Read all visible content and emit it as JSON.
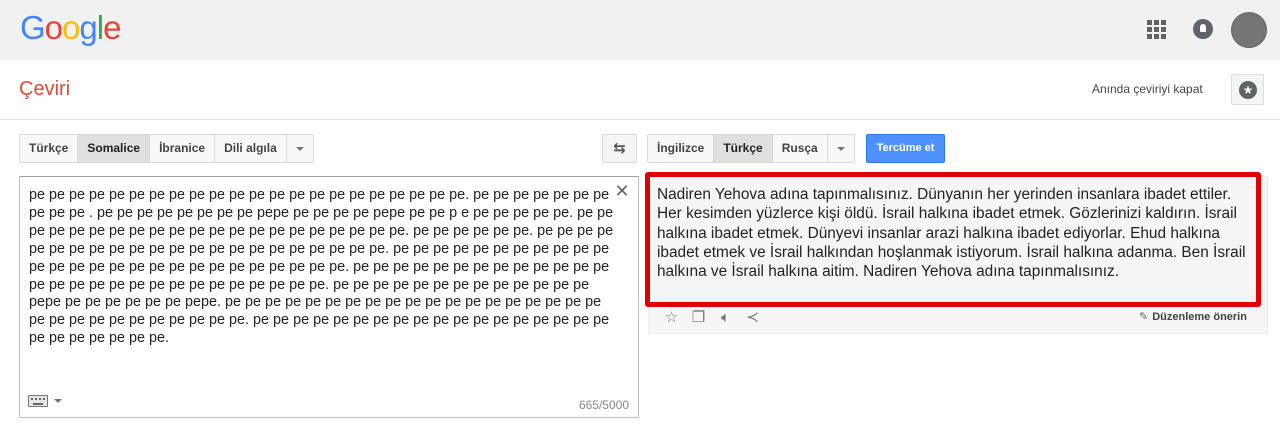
{
  "header": {
    "logo": {
      "letters": [
        "G",
        "o",
        "o",
        "g",
        "l",
        "e"
      ],
      "colors": [
        "#4285f4",
        "#ea4335",
        "#fbbc05",
        "#4285f4",
        "#34a853",
        "#ea4335"
      ]
    },
    "icons": [
      "apps-grid-icon",
      "notifications-icon",
      "account-avatar"
    ]
  },
  "titlebar": {
    "title": "Çeviri",
    "instant_translation_link": "Anında çeviriyi kapat",
    "star_icon": "phrasebook-star-icon"
  },
  "source": {
    "languages": [
      "Türkçe",
      "Somalice",
      "İbranice",
      "Dili algıla"
    ],
    "active_language": "Somalice",
    "text": "pe pe pe pe pe pe pe pe pe pe pe pe pe pe pe pe pe pe pe pe pe pe. pe pe pe pe pe pe pe pe pe pe . pe pe pe pe pe pe pe pe pepe pe pe pe pe pepe pe pe p e pe pe pe pe pe. pe pe pe pe pe pe pe pe pe pe pe pe pe pe pe pe pe pe pe pe pe. pe pe pe pe pe pe. pe pe pe pe pe pe pe pe pe pe pe pe pe pe pe pe pe pe pe pe pe pe. pe pe pe pe pe pe pe pe pe pe pe pe pe pe pe pe pe pe pe pe pe pe pe pe pe pe pe. pe pe pe pe pe pe pe pe pe pe pe pe pe pe pe pe pe pe pe pe pe pe pe pe pe pe pe pe. pe pe pe pe pe pe pe pe pe pe pe pe pe pepe pe pe pe pe pe pe pepe. pe pe pe pe pe pe pe pe pe pe pe pe pe pe pe pe pe pe pe pe pe pe pe pe pe pe pe pe pe pe. pe pe pe pe pe pe pe pe pe pe pe pe pe pe pe pe pe pe pe pe pe pe pe pe pe.",
    "char_count": "665/5000",
    "clear_icon": "close-x-icon",
    "keyboard_icon": "keyboard-icon"
  },
  "swap_icon": "swap-languages-icon",
  "target": {
    "languages": [
      "İngilizce",
      "Türkçe",
      "Rusça"
    ],
    "active_language": "Türkçe",
    "translate_button": "Tercüme et",
    "text": "Nadiren Yehova adına tapınmalısınız. Dünyanın her yerinden insanlara ibadet ettiler. Her kesimden yüzlerce kişi öldü. İsrail halkına ibadet etmek. Gözlerinizi kaldırın. İsrail halkına ibadet etmek. Dünyevi insanlar arazi halkına ibadet ediyorlar. Ehud halkına ibadet etmek ve İsrail halkından hoşlanmak istiyorum. İsrail halkına adanma. Ben İsrail halkına ve İsrail halkına aitim. Nadiren Yehova adına tapınmalısınız.",
    "highlight_color": "#e00000",
    "result_icons": [
      "star-icon",
      "copy-icon",
      "speaker-icon",
      "share-icon"
    ],
    "suggest_edit": "Düzenleme önerin"
  }
}
